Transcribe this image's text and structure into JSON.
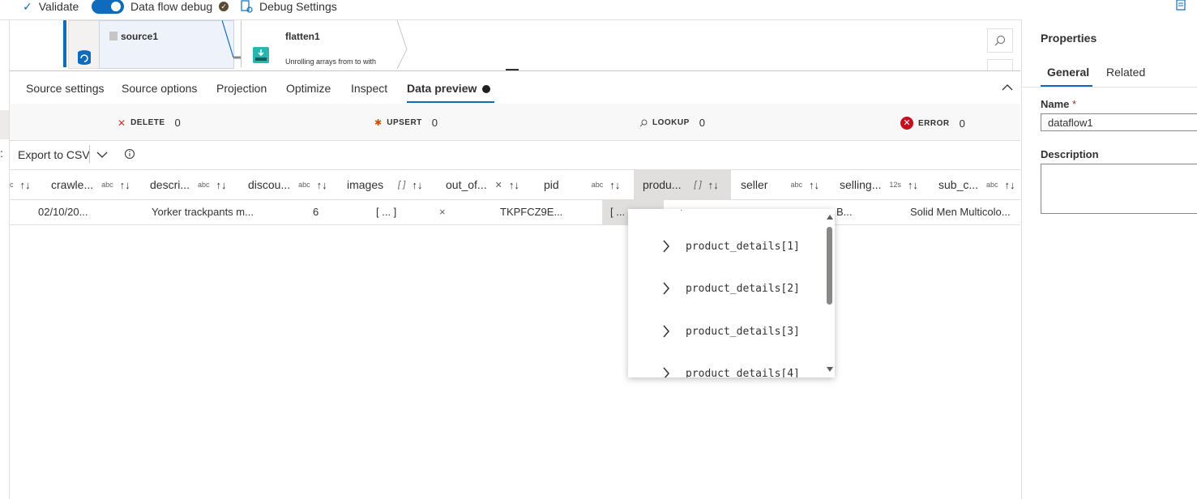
{
  "toolbar": {
    "validate": "Validate",
    "dataflow_debug": "Data flow debug",
    "debug_settings": "Debug Settings"
  },
  "canvas": {
    "source_node": "source1",
    "flatten_node": "flatten1",
    "flatten_desc": "Unrolling arrays from  to  with"
  },
  "tabs": [
    "Source settings",
    "Source options",
    "Projection",
    "Optimize",
    "Inspect",
    "Data preview"
  ],
  "counters": {
    "delete": {
      "label": "DELETE",
      "value": "0"
    },
    "upsert": {
      "label": "UPSERT",
      "value": "0"
    },
    "lookup": {
      "label": "LOOKUP",
      "value": "0"
    },
    "error": {
      "label": "ERROR",
      "value": "0"
    }
  },
  "export_label": "Export to CSV",
  "columns": [
    {
      "name": "crawle...",
      "type": "abc"
    },
    {
      "name": "descri...",
      "type": "abc"
    },
    {
      "name": "discou...",
      "type": "abc"
    },
    {
      "name": "images",
      "type": "[ ]"
    },
    {
      "name": "out_of...",
      "type": "✕"
    },
    {
      "name": "pid",
      "type": "abc"
    },
    {
      "name": "produ...",
      "type": "[ ]"
    },
    {
      "name": "seller",
      "type": "abc"
    },
    {
      "name": "selling...",
      "type": "12s"
    },
    {
      "name": "sub_c...",
      "type": "abc"
    }
  ],
  "row": {
    "crawled": "02/10/20...",
    "description": "Yorker trackpants m...",
    "discount": "6",
    "images": "[ ... ]",
    "out_of_stock": "×",
    "pid": "TKPFCZ9E...",
    "product": "[ ...",
    "seller": "B...",
    "sub_category": "Solid Men Multicolo..."
  },
  "dropdown_items": [
    "product_details[1]",
    "product_details[2]",
    "product_details[3]",
    "product_details[4]"
  ],
  "properties": {
    "title": "Properties",
    "tab_general": "General",
    "tab_related": "Related",
    "name_label": "Name",
    "required": "*",
    "name_value": "dataflow1",
    "description_label": "Description"
  }
}
